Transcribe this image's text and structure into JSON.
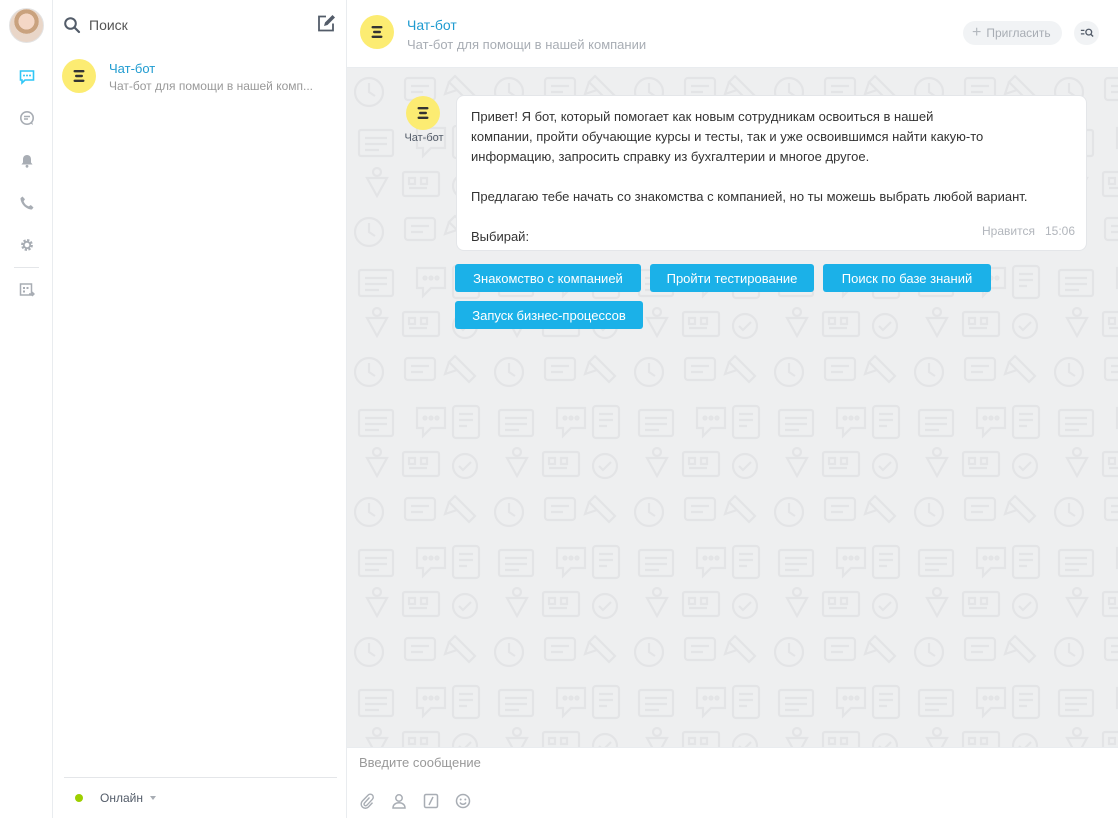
{
  "sidebar": {
    "icons": [
      "chat-icon",
      "open-lines-icon",
      "bell-icon",
      "phone-icon",
      "gear-icon",
      "market-icon"
    ]
  },
  "list": {
    "search_placeholder": "Поиск",
    "chats": [
      {
        "name": "Чат-бот",
        "subtitle": "Чат-бот для помощи в нашей комп..."
      }
    ],
    "status_label": "Онлайн"
  },
  "header": {
    "title": "Чат-бот",
    "subtitle": "Чат-бот для помощи в нашей компании",
    "invite_label": "Пригласить"
  },
  "message": {
    "author": "Чат-бот",
    "lines_1": [
      "Привет! Я бот, который помогает как новым сотрудникам освоиться в нашей",
      "компании, пройти обучающие курсы и тесты, так и уже освоившимся найти какую-то",
      "информацию, запросить справку из бухгалтерии и многое другое."
    ],
    "line_2": "Предлагаю тебе начать со знакомства с компанией, но ты можешь выбрать любой вариант.",
    "line_3": "Выбирай:",
    "like_label": "Нравится",
    "time": "15:06"
  },
  "keyboard": {
    "buttons": [
      "Знакомство с компанией",
      "Пройти тестирование",
      "Поиск по базе знаний",
      "Запуск бизнес-процессов"
    ]
  },
  "composer": {
    "placeholder": "Введите сообщение"
  },
  "colors": {
    "accent": "#1f9bd0",
    "button": "#1bb1e8",
    "bot_avatar": "#fcec72",
    "online": "#9dcf00"
  }
}
